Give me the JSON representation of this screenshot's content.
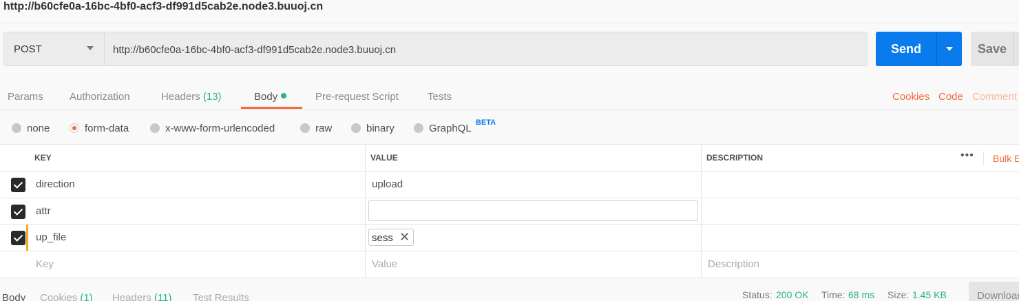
{
  "window": {
    "title": "http://b60cfe0a-16bc-4bf0-acf3-df991d5cab2e.node3.buuoj.cn"
  },
  "request": {
    "method": "POST",
    "url": "http://b60cfe0a-16bc-4bf0-acf3-df991d5cab2e.node3.buuoj.cn",
    "send_label": "Send",
    "save_label": "Save"
  },
  "tabs": {
    "params": "Params",
    "authorization": "Authorization",
    "headers": "Headers",
    "headers_count": "(13)",
    "body": "Body",
    "prerequest": "Pre-request Script",
    "tests": "Tests",
    "cookies": "Cookies",
    "code": "Code",
    "comments": "Comment"
  },
  "body_types": {
    "none": "none",
    "form_data": "form-data",
    "urlencoded": "x-www-form-urlencoded",
    "raw": "raw",
    "binary": "binary",
    "graphql": "GraphQL",
    "beta": "BETA",
    "selected": "form-data"
  },
  "table": {
    "headers": {
      "key": "KEY",
      "value": "VALUE",
      "description": "DESCRIPTION"
    },
    "more": "•••",
    "bulk_edit": "Bulk Edit",
    "rows": [
      {
        "key": "direction",
        "value": "upload",
        "checked": true
      },
      {
        "key": "attr",
        "value": "",
        "checked": true
      },
      {
        "key": "up_file",
        "file": "sess",
        "checked": true
      }
    ],
    "placeholders": {
      "key": "Key",
      "value": "Value",
      "description": "Description"
    }
  },
  "response": {
    "tabs": {
      "body": "Body",
      "cookies": "Cookies",
      "cookies_count": "(1)",
      "headers": "Headers",
      "headers_count": "(11)",
      "test_results": "Test Results"
    },
    "status_label": "Status:",
    "status_value": "200 OK",
    "time_label": "Time:",
    "time_value": "68 ms",
    "size_label": "Size:",
    "size_value": "1.45 KB",
    "download_label": "Download"
  },
  "colors": {
    "accent": "#f26b3a",
    "send": "#097bed",
    "success": "#26b47f"
  }
}
